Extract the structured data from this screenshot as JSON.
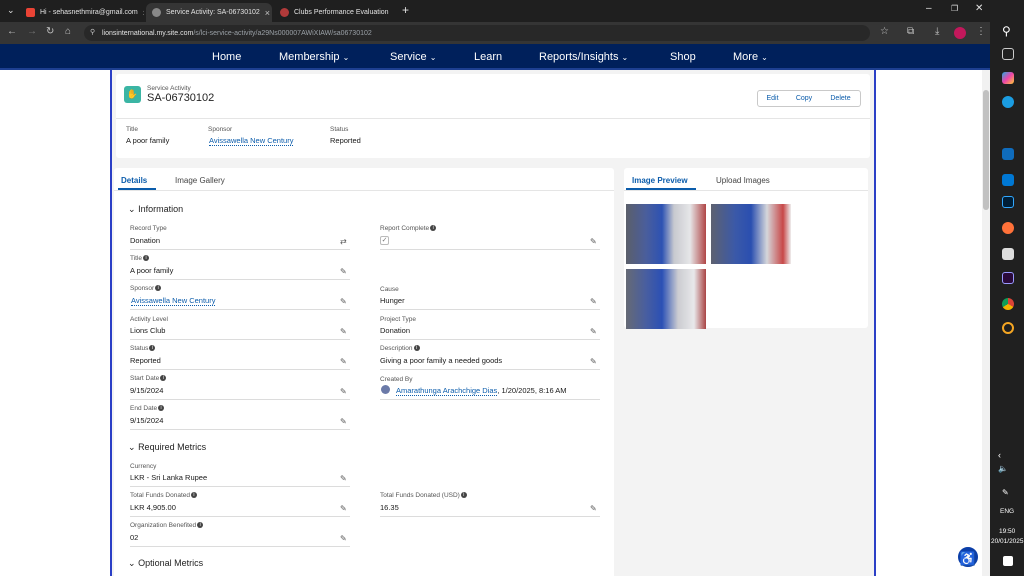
{
  "browser": {
    "tabs": [
      {
        "label": "Hi - sehasnethmira@gmail.com"
      },
      {
        "label": "Service Activity: SA-06730102"
      },
      {
        "label": "Clubs Performance Evaluation"
      }
    ],
    "url_host": "lionsinternational.my.site.com",
    "url_path": "/s/lci-service-activity/a29Ns000007AWiXIAW/sa06730102"
  },
  "nav": {
    "items": [
      "Home",
      "Membership",
      "Service",
      "Learn",
      "Reports/Insights",
      "Shop",
      "More"
    ]
  },
  "record": {
    "object_label": "Service Activity",
    "name": "SA-06730102",
    "buttons": {
      "edit": "Edit",
      "copy": "Copy",
      "delete": "Delete"
    },
    "highlights": {
      "title_label": "Title",
      "title_value": "A poor family",
      "sponsor_label": "Sponsor",
      "sponsor_value": "Avissawella New Century",
      "status_label": "Status",
      "status_value": "Reported"
    }
  },
  "left_tabs": {
    "details": "Details",
    "gallery": "Image Gallery"
  },
  "right_tabs": {
    "preview": "Image Preview",
    "upload": "Upload Images"
  },
  "sections": {
    "information": "Information",
    "required": "Required Metrics",
    "optional": "Optional Metrics"
  },
  "fields": {
    "record_type": {
      "label": "Record Type",
      "value": "Donation"
    },
    "report_complete": {
      "label": "Report Complete"
    },
    "title": {
      "label": "Title",
      "value": "A poor family"
    },
    "sponsor": {
      "label": "Sponsor",
      "value": "Avissawella New Century"
    },
    "cause": {
      "label": "Cause",
      "value": "Hunger"
    },
    "activity_level": {
      "label": "Activity Level",
      "value": "Lions Club"
    },
    "project_type": {
      "label": "Project Type",
      "value": "Donation"
    },
    "status": {
      "label": "Status",
      "value": "Reported"
    },
    "description": {
      "label": "Description",
      "value": "Giving a poor family a needed goods"
    },
    "start_date": {
      "label": "Start Date",
      "value": "9/15/2024"
    },
    "created_by": {
      "label": "Created By",
      "user": "Amarathunga Arachchige Dias",
      "date": ", 1/20/2025, 8:16 AM"
    },
    "end_date": {
      "label": "End Date",
      "value": "9/15/2024"
    },
    "currency": {
      "label": "Currency",
      "value": "LKR - Sri Lanka Rupee"
    },
    "total_funds": {
      "label": "Total Funds Donated",
      "value": "LKR 4,905.00"
    },
    "total_funds_usd": {
      "label": "Total Funds Donated (USD)",
      "value": "16.35"
    },
    "org_benefited": {
      "label": "Organization Benefited",
      "value": "02"
    }
  },
  "system": {
    "lang": "ENG",
    "time": "19:50",
    "date": "20/01/2025"
  },
  "colors": {
    "nav_bg": "#00205b",
    "accent": "#0b5cab",
    "frame": "#2b3fc6"
  }
}
